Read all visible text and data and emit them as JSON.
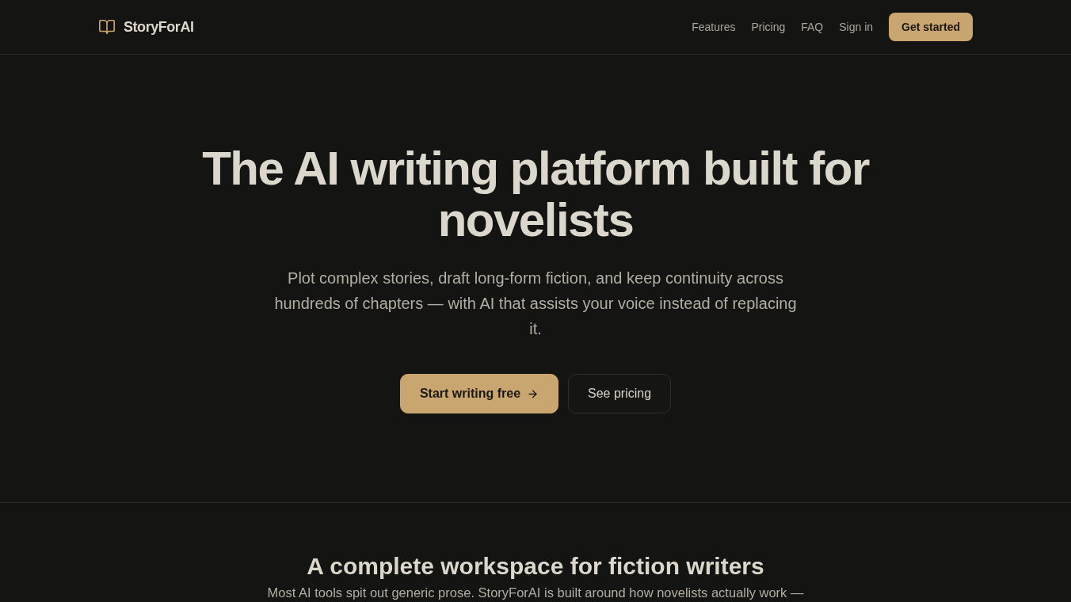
{
  "header": {
    "logo": {
      "text": "StoryForAI"
    },
    "nav_links": [
      "Features",
      "Pricing",
      "FAQ",
      "Sign in"
    ],
    "cta_button": "Get started"
  },
  "hero": {
    "title": "The AI writing platform built for novelists",
    "subtitle": "Plot complex stories, draft long-form fiction, and keep continuity across hundreds of chapters — with AI that assists your voice instead of replacing it.",
    "buttons": [
      {
        "label": "Start writing free",
        "kind": "primary"
      },
      {
        "label": "See pricing",
        "kind": "secondary"
      }
    ]
  },
  "features_section": {
    "heading": "A complete workspace for fiction writers",
    "intro": "Most AI tools spit out generic prose. StoryForAI is built around how novelists actually work —"
  }
}
